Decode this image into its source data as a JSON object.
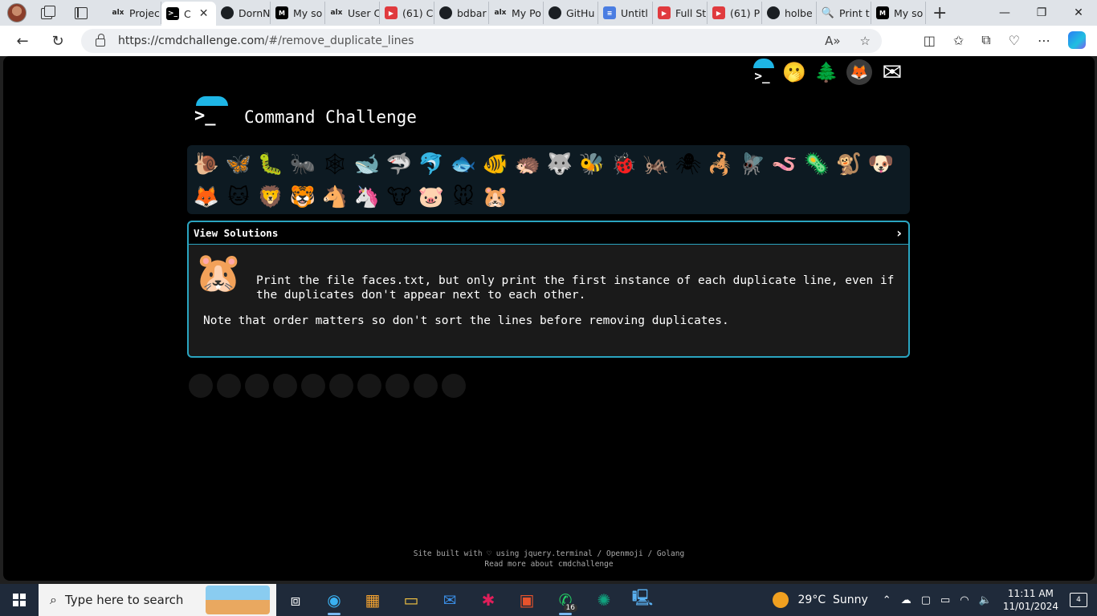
{
  "browser": {
    "tabs": [
      {
        "fav": "alx",
        "fav_text": "alx",
        "label": "Projec"
      },
      {
        "fav": "term",
        "fav_text": ">_",
        "label": "C",
        "active": true
      },
      {
        "fav": "gh",
        "fav_text": "",
        "label": "DornN"
      },
      {
        "fav": "med",
        "fav_text": "M",
        "label": "My so"
      },
      {
        "fav": "alx",
        "fav_text": "alx",
        "label": "User C"
      },
      {
        "fav": "yt",
        "fav_text": "▶",
        "label": "(61) C"
      },
      {
        "fav": "gh",
        "fav_text": "",
        "label": "bdbar"
      },
      {
        "fav": "alx",
        "fav_text": "alx",
        "label": "My Po"
      },
      {
        "fav": "gh",
        "fav_text": "",
        "label": "GitHu"
      },
      {
        "fav": "doc",
        "fav_text": "≡",
        "label": "Untitl"
      },
      {
        "fav": "yt",
        "fav_text": "▶",
        "label": "Full St"
      },
      {
        "fav": "yt",
        "fav_text": "▶",
        "label": "(61) P"
      },
      {
        "fav": "gh",
        "fav_text": "",
        "label": "holbe"
      },
      {
        "fav": "search",
        "fav_text": "🔍",
        "label": "Print t"
      },
      {
        "fav": "med",
        "fav_text": "M",
        "label": "My so"
      }
    ],
    "url_host": "https://cmdchallenge.com",
    "url_path": "/#/remove_duplicate_lines"
  },
  "page": {
    "title": "Command Challenge",
    "logo_prompt": ">_",
    "top_icons": [
      "terminal-logo-icon",
      "surprised-face-icon",
      "tree-icon",
      "gitlab-icon",
      "envelope-icon"
    ],
    "animals": [
      "🐌",
      "🦋",
      "🐛",
      "🐜",
      "🕸",
      "🐋",
      "🦈",
      "🐬",
      "🐟",
      "🐠",
      "🦔",
      "🐺",
      "🐝",
      "🐞",
      "🦗",
      "🕷",
      "🦂",
      "🪰",
      "🪱",
      "🦠",
      "🐒",
      "🐶",
      "🦊",
      "🐱",
      "🦁",
      "🐯",
      "🐴",
      "🦄",
      "🐮",
      "🐷",
      "🐭",
      "🐹"
    ],
    "solutions_label": "View Solutions",
    "challenge_emoji": "🐹",
    "description": "Print the file faces.txt, but only print the first instance of each duplicate line, even if the duplicates don't appear next to each other.",
    "note": "Note that order matters so don't sort the lines before removing duplicates.",
    "footer_line1": "Site built with ♡ using jquery.terminal / Openmoji / Golang",
    "footer_line2": "Read more about cmdchallenge"
  },
  "taskbar": {
    "search_placeholder": "Type here to search",
    "badge_count": "16",
    "temperature": "29°C",
    "weather": "Sunny",
    "time": "11:11 AM",
    "date": "11/01/2024",
    "notifications": "4"
  },
  "colors": {
    "accent": "#1eb6e6",
    "panel_border": "#2aa4c0"
  }
}
